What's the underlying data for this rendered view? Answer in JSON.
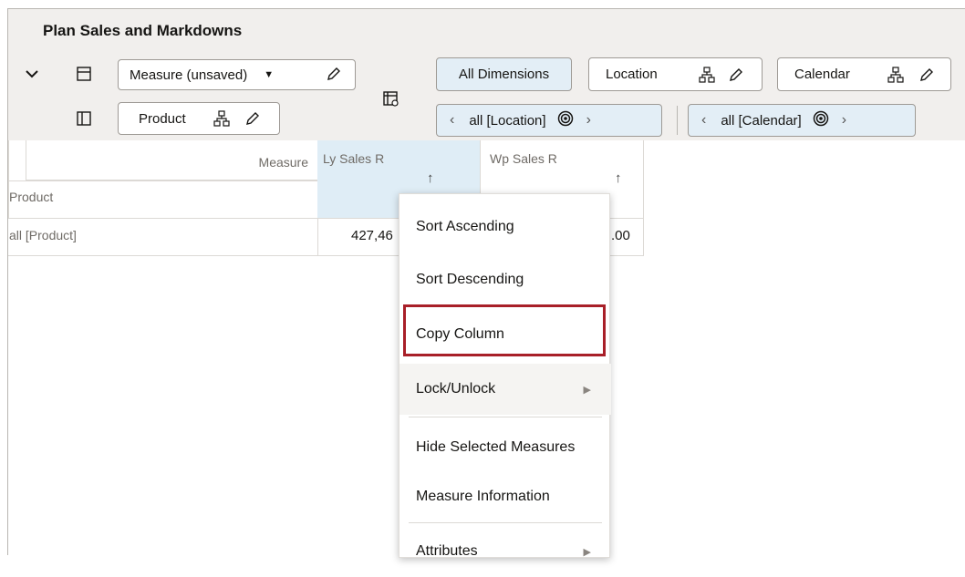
{
  "title": "Plan Sales and Markdowns",
  "toolbar": {
    "collapse_icon": "chevron-down-icon",
    "measure_label": "Measure (unsaved)",
    "product_label": "Product",
    "all_dimensions_label": "All Dimensions",
    "location_label": "Location",
    "calendar_label": "Calendar",
    "location_value": "all [Location]",
    "calendar_value": "all [Calendar]"
  },
  "grid": {
    "measure_header": "Measure",
    "product_header": "Product",
    "columns": [
      "Ly Sales R",
      "Wp Sales R"
    ],
    "row_label": "all [Product]",
    "ly_value": "427,46",
    "wp_value": ".00"
  },
  "context_menu": {
    "items": [
      "Sort Ascending",
      "Sort Descending",
      "Copy Column",
      "Lock/Unlock",
      "Hide Selected Measures",
      "Measure Information",
      "Attributes"
    ],
    "highlighted": "Copy Column",
    "highlight_color": "#a81f28"
  },
  "colors": {
    "selected_column": "#dfedf6",
    "toolbar_bg": "#f1efed",
    "blue_chip": "#e3eef6"
  }
}
